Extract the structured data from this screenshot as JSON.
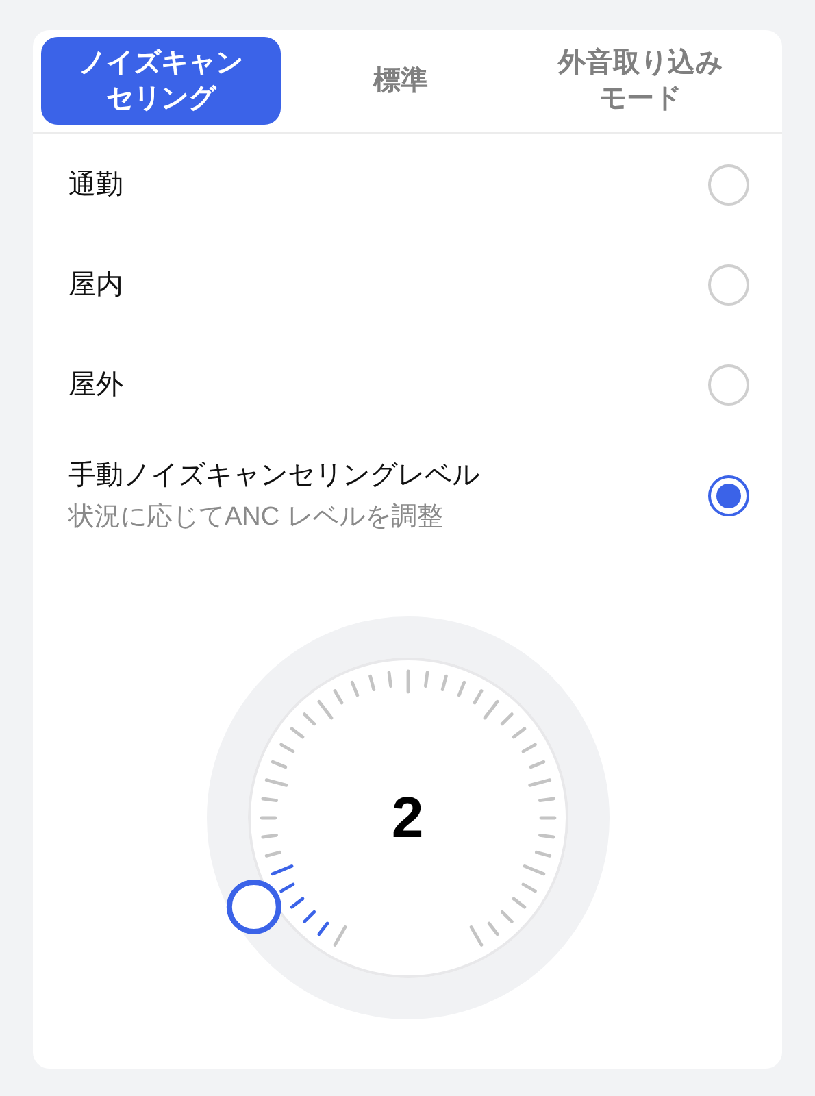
{
  "tabs": [
    {
      "label": "ノイズキャンセリング",
      "selected": true
    },
    {
      "label": "標準",
      "selected": false
    },
    {
      "label": "外音取り込みモード",
      "selected": false
    }
  ],
  "modes": [
    {
      "label": "通勤",
      "selected": false
    },
    {
      "label": "屋内",
      "selected": false
    },
    {
      "label": "屋外",
      "selected": false
    },
    {
      "label": "手動ノイズキャンセリングレベル",
      "description": "状況に応じてANC レベルを調整",
      "selected": true
    }
  ],
  "dial": {
    "value": "2",
    "level": 0.1
  }
}
